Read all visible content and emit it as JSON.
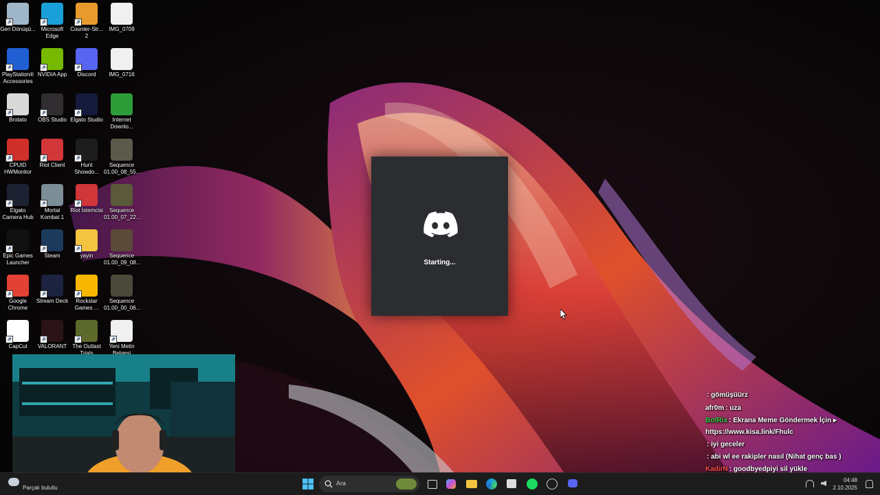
{
  "desktop_icons": [
    {
      "id": "recycle",
      "label": "Geri Dönüşü...",
      "icon": "recycle-bin-icon",
      "color": "#9fb6c8"
    },
    {
      "id": "edge",
      "label": "Microsoft Edge",
      "icon": "edge-icon",
      "color": "#1aa0d8"
    },
    {
      "id": "cs2",
      "label": "Counter-Str... 2",
      "icon": "counter-strike-icon",
      "color": "#e89a2c"
    },
    {
      "id": "img0709",
      "label": "IMG_0709",
      "icon": "video-file-icon",
      "color": "#f0f0f0"
    },
    {
      "id": "ps",
      "label": "PlayStation® Accessories",
      "icon": "playstation-icon",
      "color": "#1f5fd1"
    },
    {
      "id": "nvidia",
      "label": "NVIDIA App",
      "icon": "nvidia-icon",
      "color": "#76b900"
    },
    {
      "id": "discord",
      "label": "Discord",
      "icon": "discord-icon",
      "color": "#5865f2"
    },
    {
      "id": "img0716",
      "label": "IMG_0716",
      "icon": "video-file-icon",
      "color": "#f0f0f0"
    },
    {
      "id": "brotato",
      "label": "Brotato",
      "icon": "brotato-icon",
      "color": "#d9d9d9"
    },
    {
      "id": "obs",
      "label": "OBS Studio",
      "icon": "obs-icon",
      "color": "#302e31"
    },
    {
      "id": "elgato",
      "label": "Elgato Studio",
      "icon": "elgato-studio-icon",
      "color": "#141a3c"
    },
    {
      "id": "idm",
      "label": "Internet Downlo...",
      "icon": "internet-download-manager-icon",
      "color": "#2d9d3a"
    },
    {
      "id": "cpuid",
      "label": "CPUID HWMonitor",
      "icon": "hwmonitor-icon",
      "color": "#d0302a"
    },
    {
      "id": "riot",
      "label": "Riot Client",
      "icon": "riot-client-icon",
      "color": "#d13639"
    },
    {
      "id": "hunt",
      "label": "Hunt Showdo...",
      "icon": "hunt-showdown-icon",
      "color": "#1d1d1d"
    },
    {
      "id": "seq1",
      "label": "Sequence 01.00_08_55...",
      "icon": "video-thumbnail-icon",
      "color": "#5a5a4a"
    },
    {
      "id": "camhub",
      "label": "Elgato Camera Hub",
      "icon": "camera-hub-icon",
      "color": "#1d2233"
    },
    {
      "id": "mk1",
      "label": "Mortal Kombat 1",
      "icon": "mortal-kombat-icon",
      "color": "#7b8d96"
    },
    {
      "id": "riotist",
      "label": "Riot İstemcisi",
      "icon": "riot-client-icon",
      "color": "#d13639"
    },
    {
      "id": "seq2",
      "label": "Sequence 01.00_07_22...",
      "icon": "video-thumbnail-icon",
      "color": "#5a5a3a"
    },
    {
      "id": "epic",
      "label": "Epic Games Launcher",
      "icon": "epic-games-icon",
      "color": "#111111"
    },
    {
      "id": "steam",
      "label": "Steam",
      "icon": "steam-icon",
      "color": "#1b3a5c"
    },
    {
      "id": "yayin",
      "label": "yayin",
      "icon": "folder-icon",
      "color": "#f3c440"
    },
    {
      "id": "seq3",
      "label": "Sequence 01.00_09_08...",
      "icon": "video-thumbnail-icon",
      "color": "#5a4a3a"
    },
    {
      "id": "chrome",
      "label": "Google Chrome",
      "icon": "chrome-icon",
      "color": "#e34133"
    },
    {
      "id": "streamdeck",
      "label": "Stream Deck",
      "icon": "stream-deck-icon",
      "color": "#1c2340"
    },
    {
      "id": "rockstar",
      "label": "Rockstar Games ...",
      "icon": "rockstar-icon",
      "color": "#f7b700"
    },
    {
      "id": "seq4",
      "label": "Sequence 01.00_00_06...",
      "icon": "video-thumbnail-icon",
      "color": "#4a4a3a"
    },
    {
      "id": "capcut",
      "label": "CapCut",
      "icon": "capcut-icon",
      "color": "#ffffff"
    },
    {
      "id": "valorant",
      "label": "VALORANT",
      "icon": "valorant-icon",
      "color": "#2a1418"
    },
    {
      "id": "outlast",
      "label": "The Outlast Trials",
      "icon": "outlast-trials-icon",
      "color": "#5d6a2c"
    },
    {
      "id": "txt",
      "label": "Yeni Metin Belgesi",
      "icon": "text-file-icon",
      "color": "#f0f0f0"
    }
  ],
  "splash": {
    "status": "Starting...",
    "logo": "discord-logo-icon"
  },
  "chat": [
    {
      "user": "",
      "text": ": gömüşüürz",
      "color": "#ff4d4d"
    },
    {
      "user": "afr0m",
      "text": ": uza",
      "color": "#ffffff"
    },
    {
      "user": "BotRix",
      "text": ": Ekrana Meme Göndermek İçin ▸ https://www.kisa.link/Fhulc",
      "color": "#38d14a"
    },
    {
      "user": "",
      "text": ": iyi geceler",
      "color": "#ff4d4d"
    },
    {
      "user": "",
      "text": ": abi wl ee rakipler nasıl (Nihat genç bas )",
      "color": "#ff4d4d"
    },
    {
      "user": "KadirN",
      "text": ": goodbyedpiyi sil yükle",
      "color": "#ff4d4d"
    }
  ],
  "taskbar": {
    "search_placeholder": "Ara",
    "widget_text": "Parçalı bulutlu",
    "time": "04:48",
    "date": "2.10.2025"
  },
  "colors": {
    "splash_bg": "#2b2d31",
    "taskbar_bg": "#1c1c1c",
    "discord": "#5865f2"
  }
}
